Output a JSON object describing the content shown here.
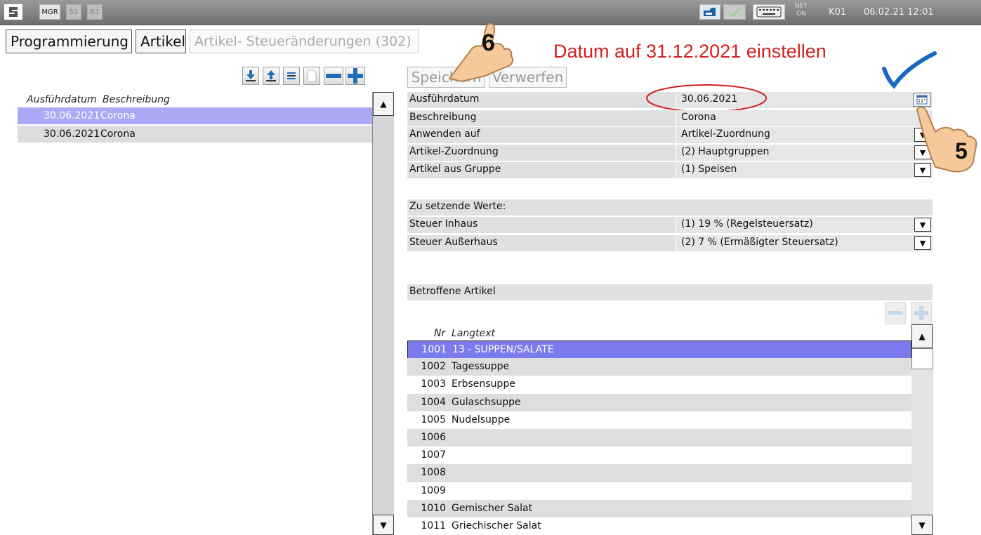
{
  "topbar": {
    "user": "MGR",
    "slot1": "S1",
    "slot2": "R1",
    "net_label": "NET",
    "net_status": "ON",
    "terminal": "K01",
    "datetime": "06.02.21 12:01"
  },
  "breadcrumb": {
    "level1": "Programmierung",
    "level2": "Artikel",
    "level3": "Artikel- Steueränderungen (302)"
  },
  "annotation": {
    "instruction": "Datum auf 31.12.2021 einstellen",
    "step_save": "6",
    "step_calendar": "5",
    "color": "#d42020"
  },
  "left_list": {
    "col_date": "Ausführdatum",
    "col_desc": "Beschreibung",
    "rows": [
      {
        "date": "30.06.2021",
        "desc": "Corona"
      },
      {
        "date": "30.06.2021",
        "desc": "Corona"
      }
    ],
    "selected_color": "#a9a9f6"
  },
  "actions": {
    "save": "Speichern",
    "discard": "Verwerfen"
  },
  "form": {
    "ausfuehrdatum": {
      "label": "Ausführdatum",
      "value": "30.06.2021"
    },
    "beschreibung": {
      "label": "Beschreibung",
      "value": "Corona"
    },
    "anwenden_auf": {
      "label": "Anwenden auf",
      "value": "Artikel-Zuordnung"
    },
    "artikel_zuordnung": {
      "label": "Artikel-Zuordnung",
      "value": "(2) Hauptgruppen"
    },
    "artikel_aus_gruppe": {
      "label": "Artikel aus Gruppe",
      "value": "(1) Speisen"
    }
  },
  "values_section": {
    "title": "Zu setzende Werte:",
    "steuer_inhaus": {
      "label": "Steuer Inhaus",
      "value": "(1) 19 % (Regelsteuersatz)"
    },
    "steuer_ausserhaus": {
      "label": "Steuer Außerhaus",
      "value": "(2) 7 % (Ermäßigter Steuersatz)"
    }
  },
  "affected": {
    "title": "Betroffene Artikel",
    "col_nr": "Nr",
    "col_text": "Langtext",
    "rows": [
      {
        "nr": "1001",
        "text": "13 - SUPPEN/SALATE"
      },
      {
        "nr": "1002",
        "text": "Tagessuppe"
      },
      {
        "nr": "1003",
        "text": "Erbsensuppe"
      },
      {
        "nr": "1004",
        "text": "Gulaschsuppe"
      },
      {
        "nr": "1005",
        "text": "Nudelsuppe"
      },
      {
        "nr": "1006",
        "text": ""
      },
      {
        "nr": "1007",
        "text": ""
      },
      {
        "nr": "1008",
        "text": ""
      },
      {
        "nr": "1009",
        "text": ""
      },
      {
        "nr": "1010",
        "text": "Gemischer Salat"
      },
      {
        "nr": "1011",
        "text": "Griechischer Salat"
      }
    ],
    "selected_color": "#7b7bef"
  },
  "icons": {
    "brand": "app-logo-icon",
    "printer": "printer-icon",
    "keyboard": "keyboard-icon",
    "calendar": "calendar-icon",
    "checkmark": "checkmark-icon",
    "hand": "pointing-hand-icon"
  }
}
